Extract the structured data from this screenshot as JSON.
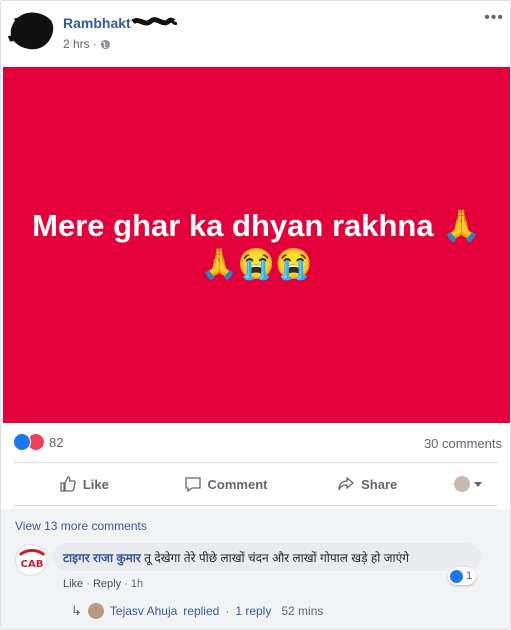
{
  "post": {
    "author": "Rambhakt",
    "time": "2 hrs",
    "separator": "·",
    "more_label": "•••",
    "banner_line1": "Mere ghar ka dhyan rakhna 🙏",
    "banner_line2": "🙏😭😭",
    "banner_color": "#e4003a"
  },
  "reactions": {
    "count": "82",
    "comments": "30 comments"
  },
  "actions": {
    "like": "Like",
    "comment": "Comment",
    "share": "Share"
  },
  "comments": {
    "view_more": "View 13 more comments",
    "items": [
      {
        "author": "टाइगर राजा कुमार",
        "text": "तू देखेगा तेरे पीछे लाखों चंदन और लाखों गोपाल खड़े हो जाएंगे",
        "avatar_text": "CAB",
        "likes": "1",
        "like_label": "Like",
        "reply_label": "Reply",
        "time": "1h",
        "dot": "·",
        "reply_summary": {
          "name": "Tejasv Ahuja",
          "action": "replied",
          "dot": "·",
          "count": "1 reply",
          "time": "52 mins",
          "arrow": "↳"
        }
      }
    ]
  }
}
